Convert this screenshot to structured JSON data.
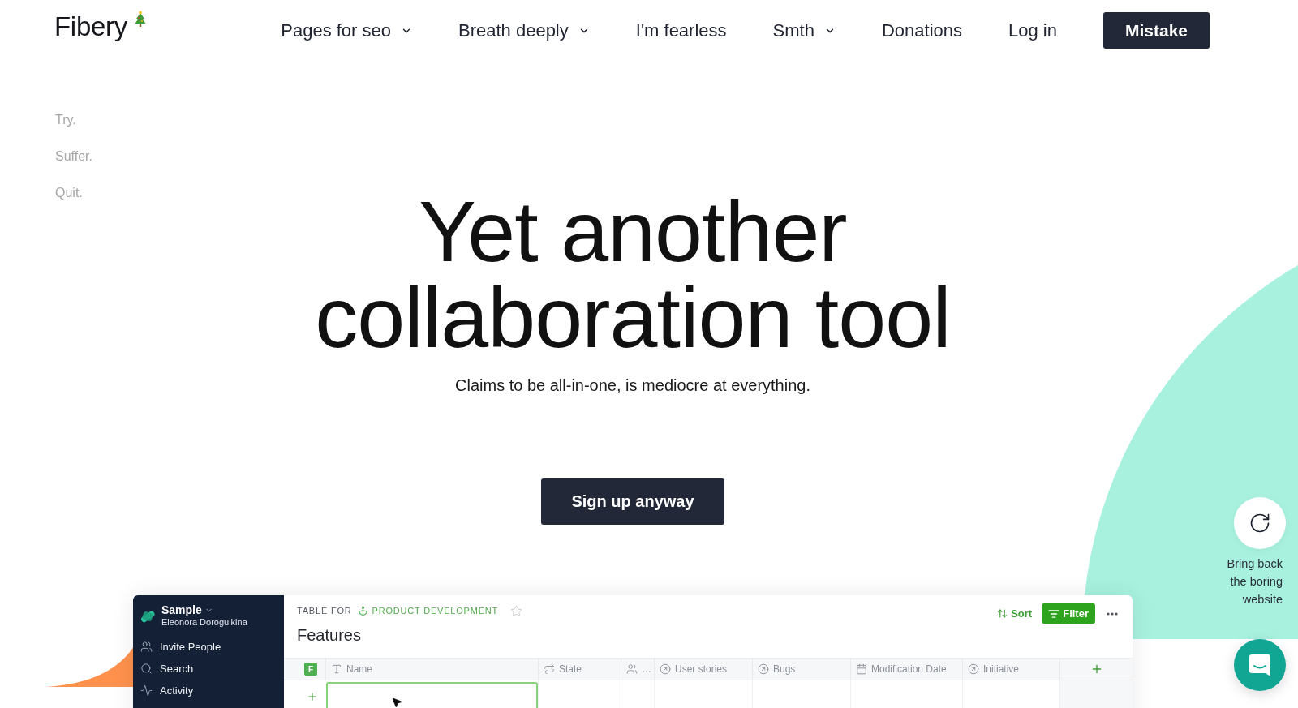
{
  "header": {
    "logo": "Fibery",
    "nav": [
      {
        "label": "Pages for seo",
        "dropdown": true
      },
      {
        "label": "Breath deeply",
        "dropdown": true
      },
      {
        "label": "I'm fearless",
        "dropdown": false
      },
      {
        "label": "Smth",
        "dropdown": true
      },
      {
        "label": "Donations",
        "dropdown": false
      },
      {
        "label": "Log in",
        "dropdown": false
      }
    ],
    "cta_button": "Mistake"
  },
  "taglines": [
    "Try.",
    "Suffer.",
    "Quit."
  ],
  "hero": {
    "title": "Yet another collaboration tool",
    "subtitle": "Claims to be all-in-one, is mediocre at everything.",
    "button": "Sign up anyway"
  },
  "app_preview": {
    "sidebar": {
      "workspace": "Sample",
      "user": "Eleonora Dorogulkina",
      "items": [
        {
          "label": "Invite People",
          "kind": "people"
        },
        {
          "label": "Search",
          "kind": "search"
        },
        {
          "label": "Activity",
          "kind": "activity"
        }
      ]
    },
    "breadcrumb": {
      "prefix": "TABLE FOR",
      "space": "PRODUCT DEVELOPMENT",
      "starred": false
    },
    "title": "Features",
    "toolbar": {
      "sort": "Sort",
      "filter": {
        "label": "Filter",
        "active": true
      }
    },
    "table": {
      "badge": "F",
      "columns": [
        {
          "label": "Name",
          "kind": "text"
        },
        {
          "label": "State",
          "kind": "workflow"
        },
        {
          "label": "…",
          "kind": "people"
        },
        {
          "label": "User stories",
          "kind": "relation"
        },
        {
          "label": "Bugs",
          "kind": "relation"
        },
        {
          "label": "Modification Date",
          "kind": "date"
        },
        {
          "label": "Initiative",
          "kind": "relation"
        }
      ],
      "new_row": {
        "editing": true
      }
    }
  },
  "restore_widget": {
    "label": "Bring back the boring website"
  }
}
